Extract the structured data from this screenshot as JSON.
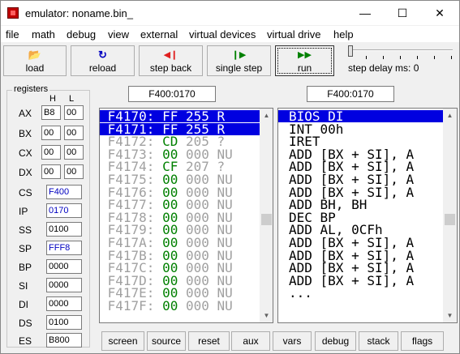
{
  "window": {
    "title": "emulator: noname.bin_",
    "minimize": "—",
    "maximize": "☐",
    "close": "✕"
  },
  "menu": [
    "file",
    "math",
    "debug",
    "view",
    "external",
    "virtual devices",
    "virtual drive",
    "help"
  ],
  "toolbar": {
    "load": {
      "label": "load",
      "icon": "open-folder-icon",
      "glyph": "📂",
      "color": "#c08000"
    },
    "reload": {
      "label": "reload",
      "icon": "reload-icon",
      "glyph": "↻",
      "color": "#0000c0"
    },
    "step_back": {
      "label": "step back",
      "icon": "step-back-icon",
      "glyph": "◀❙",
      "color": "#e02020"
    },
    "single_step": {
      "label": "single step",
      "icon": "single-step-icon",
      "glyph": "❙▶",
      "color": "#008000"
    },
    "run": {
      "label": "run",
      "icon": "run-icon",
      "glyph": "▶▶",
      "color": "#008000"
    },
    "step_delay_label": "step delay ms: 0"
  },
  "registers": {
    "group_title": "registers",
    "h_header": "H",
    "l_header": "L",
    "general": [
      {
        "name": "AX",
        "h": "B8",
        "l": "00"
      },
      {
        "name": "BX",
        "h": "00",
        "l": "00"
      },
      {
        "name": "CX",
        "h": "00",
        "l": "00"
      },
      {
        "name": "DX",
        "h": "00",
        "l": "00"
      }
    ],
    "segment": [
      {
        "name": "CS",
        "value": "F400"
      },
      {
        "name": "IP",
        "value": "0170"
      },
      {
        "name": "SS",
        "value": "0100"
      },
      {
        "name": "SP",
        "value": "FFF8"
      },
      {
        "name": "BP",
        "value": "0000"
      },
      {
        "name": "SI",
        "value": "0000"
      },
      {
        "name": "DI",
        "value": "0000"
      },
      {
        "name": "DS",
        "value": "0100"
      },
      {
        "name": "ES",
        "value": "B800"
      }
    ]
  },
  "memory": {
    "address": "F400:0170",
    "rows": [
      {
        "addr": "F4170:",
        "hex": "FF",
        "dec": "255",
        "ch": "R",
        "selected": true
      },
      {
        "addr": "F4171:",
        "hex": "FF",
        "dec": "255",
        "ch": "R",
        "selected": true
      },
      {
        "addr": "F4172:",
        "hex": "CD",
        "dec": "205",
        "ch": "?",
        "selected": false
      },
      {
        "addr": "F4173:",
        "hex": "00",
        "dec": "000",
        "ch": "NU",
        "selected": false
      },
      {
        "addr": "F4174:",
        "hex": "CF",
        "dec": "207",
        "ch": "?",
        "selected": false
      },
      {
        "addr": "F4175:",
        "hex": "00",
        "dec": "000",
        "ch": "NU",
        "selected": false
      },
      {
        "addr": "F4176:",
        "hex": "00",
        "dec": "000",
        "ch": "NU",
        "selected": false
      },
      {
        "addr": "F4177:",
        "hex": "00",
        "dec": "000",
        "ch": "NU",
        "selected": false
      },
      {
        "addr": "F4178:",
        "hex": "00",
        "dec": "000",
        "ch": "NU",
        "selected": false
      },
      {
        "addr": "F4179:",
        "hex": "00",
        "dec": "000",
        "ch": "NU",
        "selected": false
      },
      {
        "addr": "F417A:",
        "hex": "00",
        "dec": "000",
        "ch": "NU",
        "selected": false
      },
      {
        "addr": "F417B:",
        "hex": "00",
        "dec": "000",
        "ch": "NU",
        "selected": false
      },
      {
        "addr": "F417C:",
        "hex": "00",
        "dec": "000",
        "ch": "NU",
        "selected": false
      },
      {
        "addr": "F417D:",
        "hex": "00",
        "dec": "000",
        "ch": "NU",
        "selected": false
      },
      {
        "addr": "F417E:",
        "hex": "00",
        "dec": "000",
        "ch": "NU",
        "selected": false
      },
      {
        "addr": "F417F:",
        "hex": "00",
        "dec": "000",
        "ch": "NU",
        "selected": false
      }
    ]
  },
  "disassembly": {
    "address": "F400:0170",
    "rows": [
      {
        "text": "BIOS DI",
        "selected": true
      },
      {
        "text": "INT 00h",
        "selected": false
      },
      {
        "text": "IRET",
        "selected": false
      },
      {
        "text": "ADD [BX + SI], A",
        "selected": false
      },
      {
        "text": "ADD [BX + SI], A",
        "selected": false
      },
      {
        "text": "ADD [BX + SI], A",
        "selected": false
      },
      {
        "text": "ADD [BX + SI], A",
        "selected": false
      },
      {
        "text": "ADD BH, BH",
        "selected": false
      },
      {
        "text": "DEC BP",
        "selected": false
      },
      {
        "text": "ADD AL, 0CFh",
        "selected": false
      },
      {
        "text": "ADD [BX + SI], A",
        "selected": false
      },
      {
        "text": "ADD [BX + SI], A",
        "selected": false
      },
      {
        "text": "ADD [BX + SI], A",
        "selected": false
      },
      {
        "text": "ADD [BX + SI], A",
        "selected": false
      },
      {
        "text": "...",
        "selected": false
      }
    ]
  },
  "bottom_buttons": [
    "screen",
    "source",
    "reset",
    "aux",
    "vars",
    "debug",
    "stack",
    "flags"
  ]
}
